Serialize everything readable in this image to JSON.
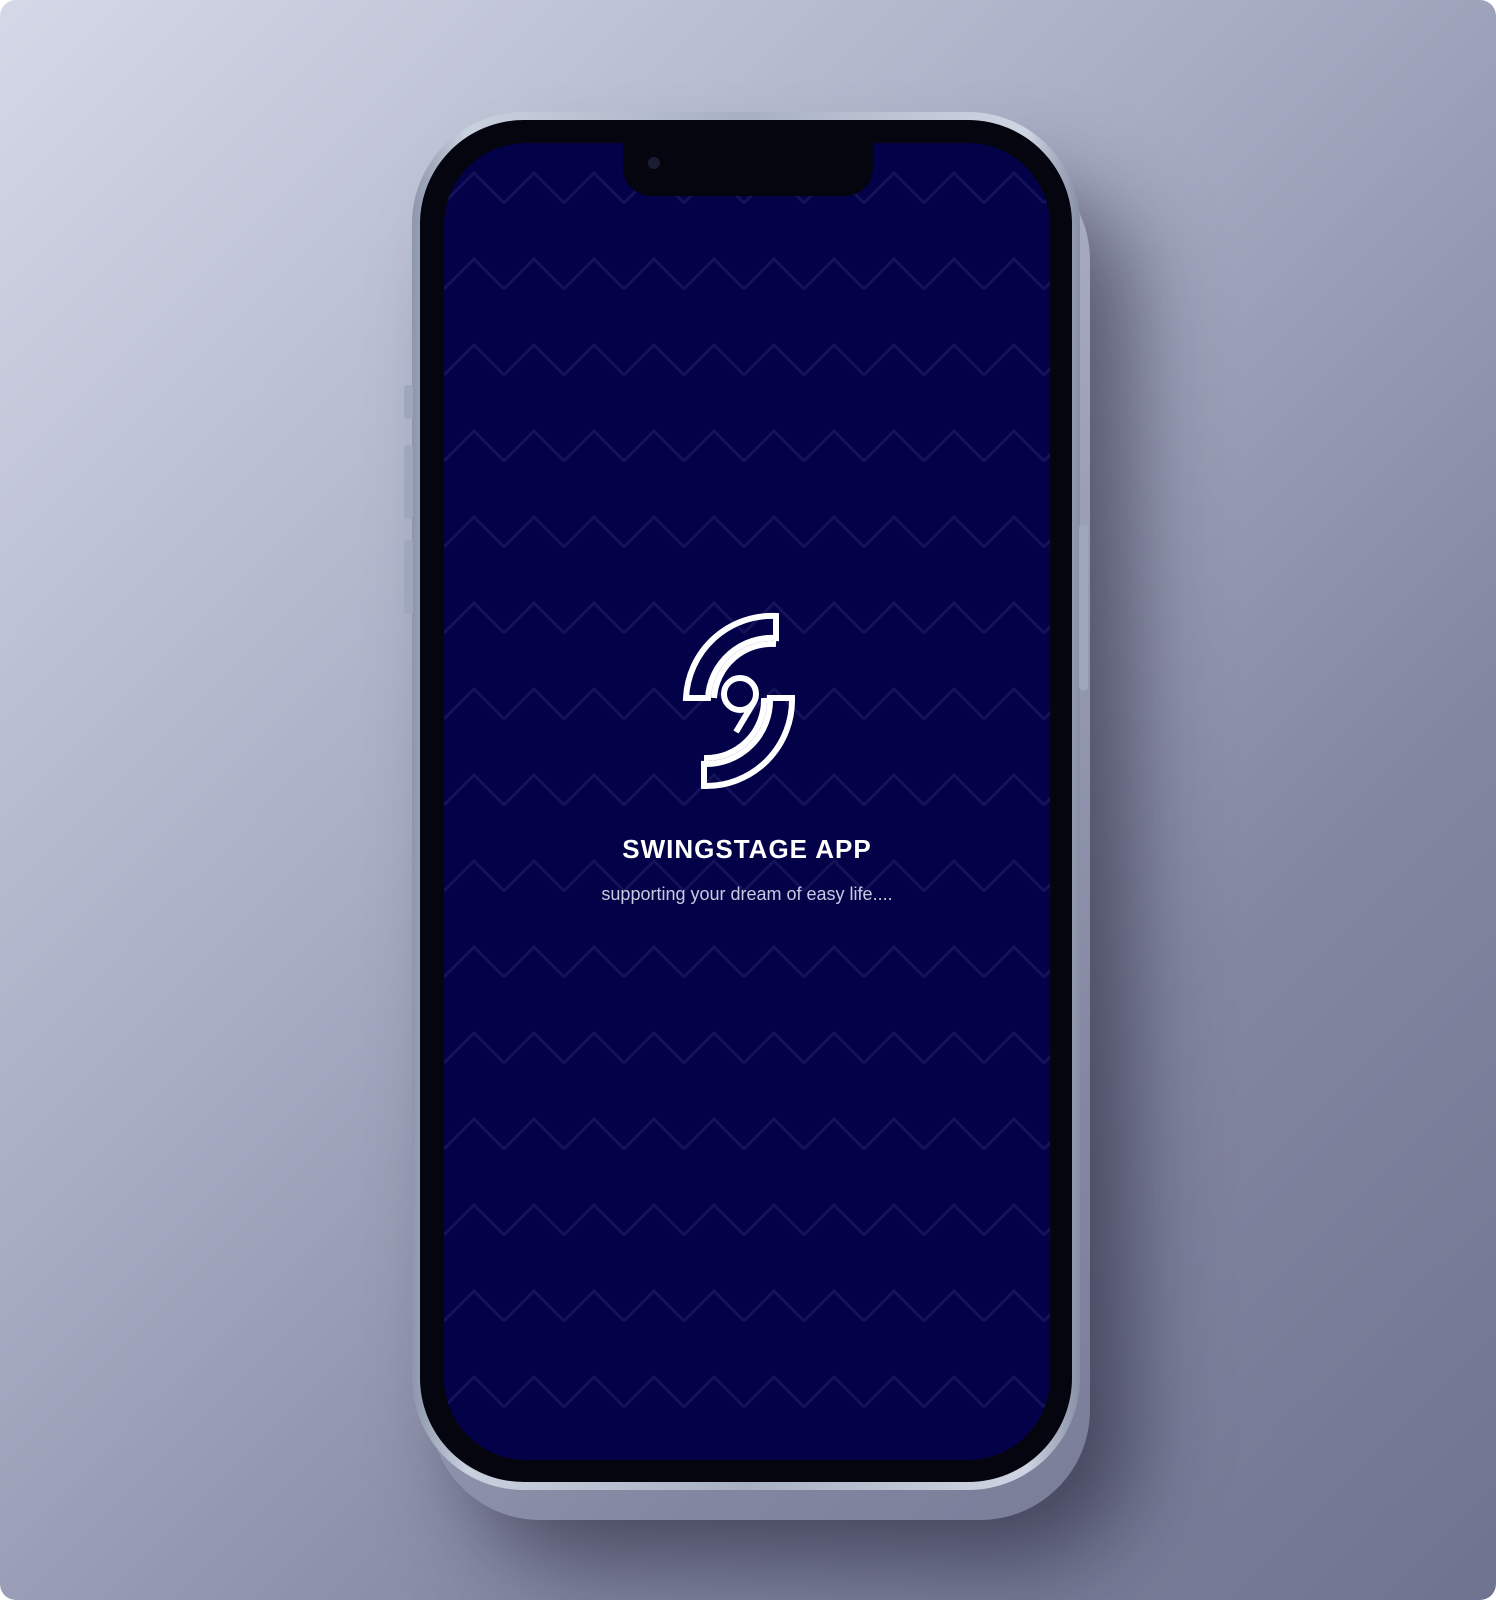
{
  "app": {
    "name": "SWINGSTAGE APP",
    "tagline": "supporting your dream of easy life....",
    "logo_icon": "swingstage-s-logo-icon"
  },
  "colors": {
    "screen_background": "#030249",
    "pattern_line": "#14135a",
    "logo": "#ffffff",
    "title": "#ffffff",
    "tagline": "#c9c9e0",
    "backdrop_start": "#d4d8e7",
    "backdrop_end": "#6f7390"
  }
}
